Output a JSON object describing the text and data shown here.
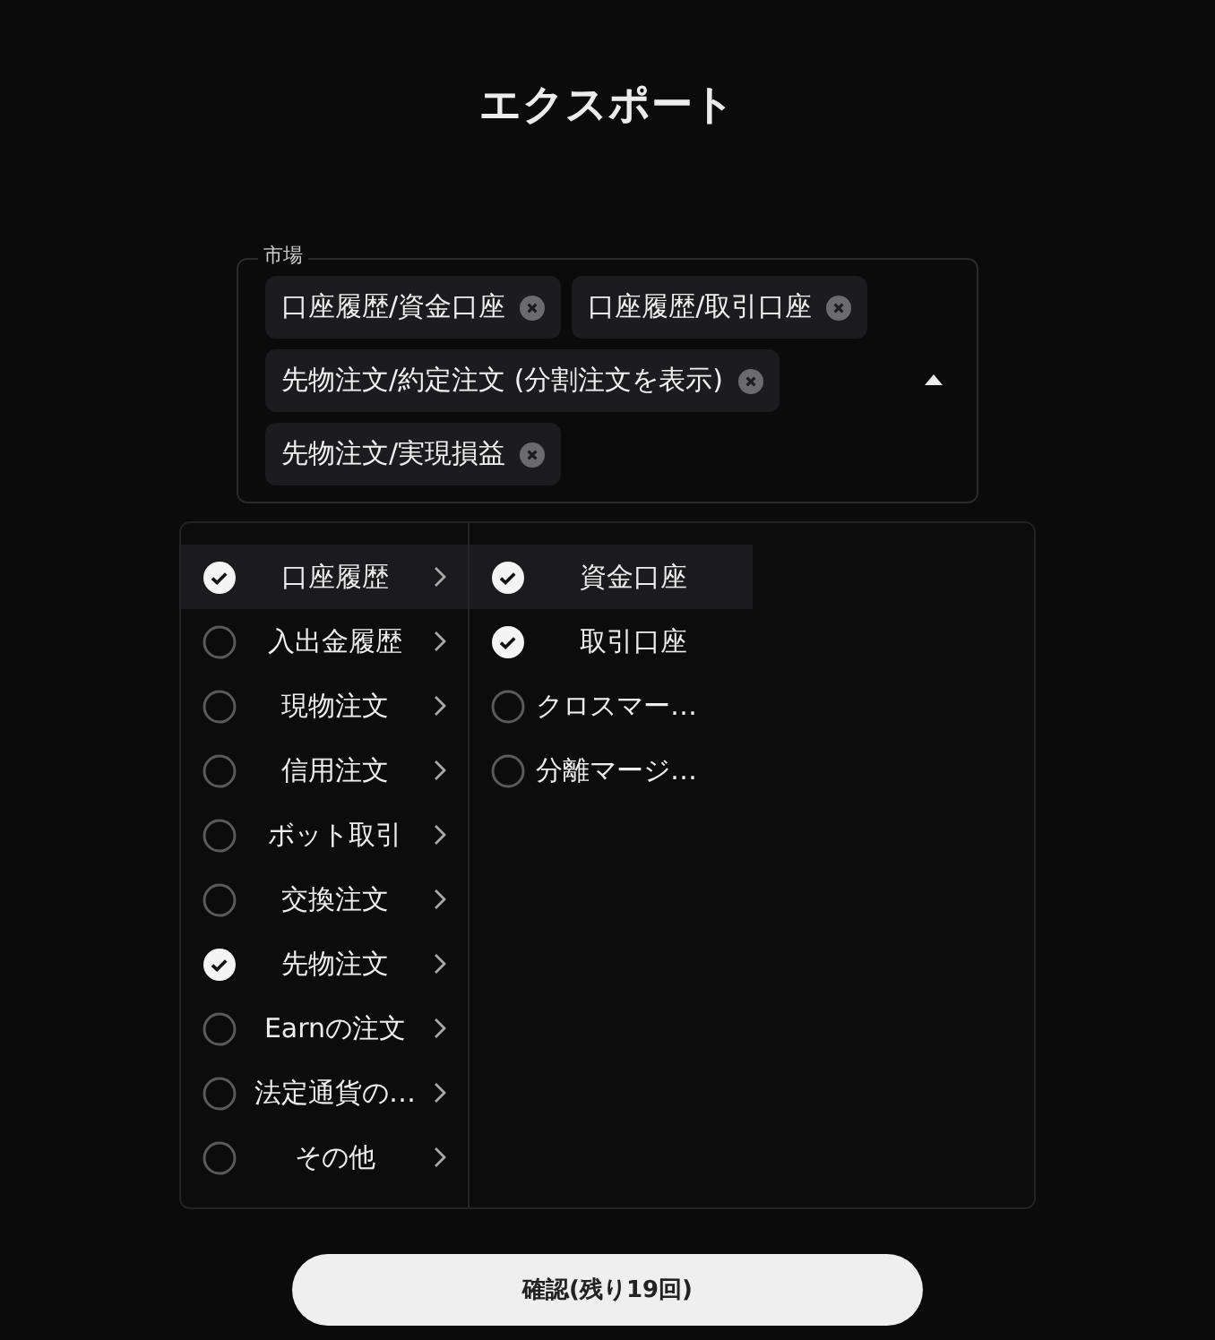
{
  "title": "エクスポート",
  "market": {
    "label": "市場",
    "expanded": true,
    "tags": [
      {
        "label": "口座履歴/資金口座"
      },
      {
        "label": "口座履歴/取引口座"
      },
      {
        "label": "先物注文/約定注文 (分割注文を表示)"
      },
      {
        "label": "先物注文/実現損益"
      }
    ]
  },
  "categories": [
    {
      "label": "口座履歴",
      "checked": true,
      "selected": true
    },
    {
      "label": "入出金履歴",
      "checked": false,
      "selected": false
    },
    {
      "label": "現物注文",
      "checked": false,
      "selected": false
    },
    {
      "label": "信用注文",
      "checked": false,
      "selected": false
    },
    {
      "label": "ボット取引",
      "checked": false,
      "selected": false
    },
    {
      "label": "交換注文",
      "checked": false,
      "selected": false
    },
    {
      "label": "先物注文",
      "checked": true,
      "selected": false
    },
    {
      "label": "Earnの注文",
      "checked": false,
      "selected": false
    },
    {
      "label": "法定通貨の…",
      "checked": false,
      "selected": false
    },
    {
      "label": "その他",
      "checked": false,
      "selected": false
    }
  ],
  "subcategories": [
    {
      "label": "資金口座",
      "checked": true,
      "selected": true
    },
    {
      "label": "取引口座",
      "checked": true,
      "selected": false
    },
    {
      "label": "クロスマー…",
      "checked": false,
      "selected": false
    },
    {
      "label": "分離マージ…",
      "checked": false,
      "selected": false
    }
  ],
  "confirm_button": "確認(残り19回)"
}
